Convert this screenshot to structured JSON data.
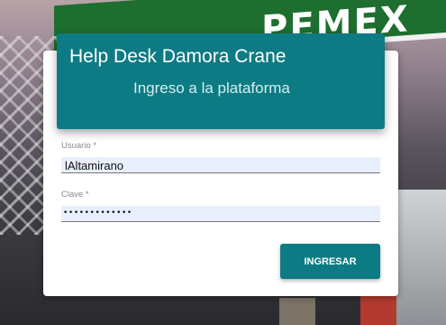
{
  "background": {
    "brand_text": "PEMEX",
    "accent_color": "#1d6e2f"
  },
  "header": {
    "title": "Help Desk Damora Crane",
    "subtitle": "Ingreso a la plataforma",
    "color": "#0d7b83"
  },
  "form": {
    "username_label": "Usuario *",
    "username_value": "lAltamirano",
    "password_label": "Clave *",
    "password_value": "•••••••••••••"
  },
  "submit": {
    "label": "INGRESAR"
  }
}
